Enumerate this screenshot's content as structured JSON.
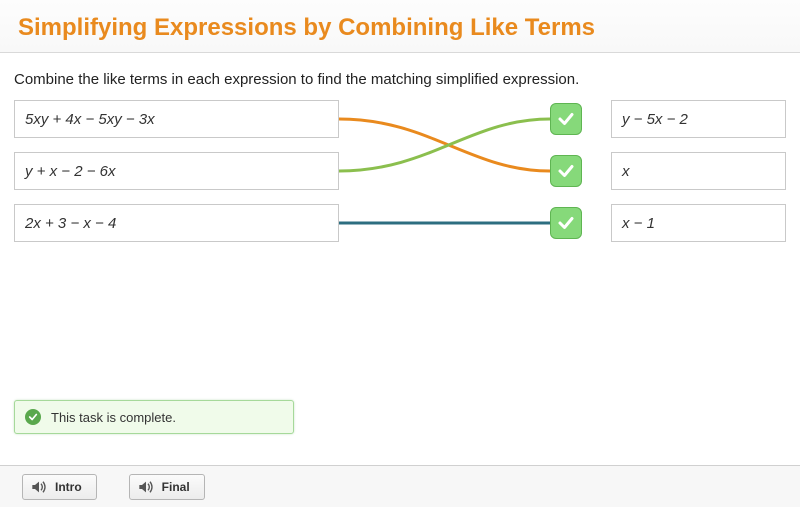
{
  "title": "Simplifying Expressions by Combining Like Terms",
  "instruction": "Combine the like terms in each expression to find the matching simplified expression.",
  "left": {
    "row0": "5xy + 4x − 5xy − 3x",
    "row1": "y + x − 2 − 6x",
    "row2": "2x + 3 − x − 4"
  },
  "right": {
    "row0": "y − 5x − 2",
    "row1": "x",
    "row2": "x − 1"
  },
  "status": "This task is complete.",
  "footer": {
    "intro": "Intro",
    "final": "Final"
  },
  "colors": {
    "line0": "#e98a1e",
    "line1": "#8bbf4e",
    "line2": "#2d6e80"
  }
}
